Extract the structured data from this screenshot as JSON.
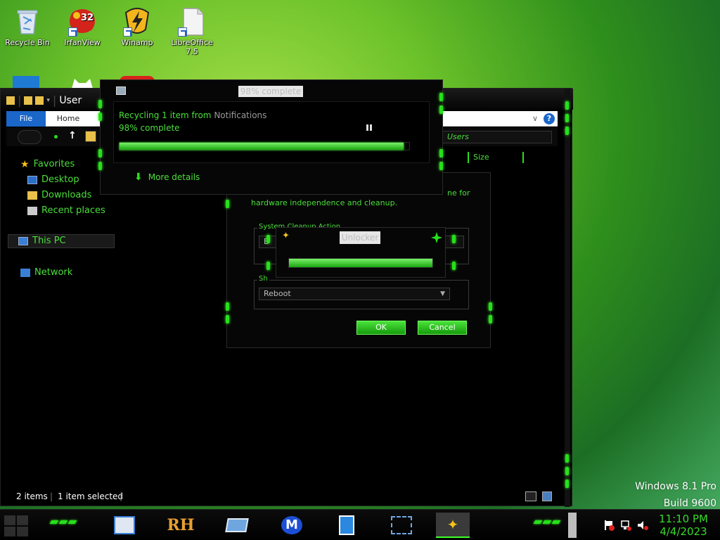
{
  "desktop": {
    "icons": [
      {
        "label": "Recycle Bin"
      },
      {
        "label": "IrfanView",
        "badge": "32"
      },
      {
        "label": "Winamp"
      },
      {
        "label": "LibreOffice 7.5"
      }
    ]
  },
  "explorer": {
    "title": "User",
    "ribbon_tabs": [
      "File",
      "Home"
    ],
    "address_text": "Users",
    "column_size": "Size",
    "nav": {
      "favorites": "Favorites",
      "desktop": "Desktop",
      "downloads": "Downloads",
      "recent": "Recent places",
      "this_pc": "This PC",
      "network": "Network"
    },
    "status": {
      "items": "2 items",
      "selected": "1 item selected"
    }
  },
  "progress_dialog": {
    "title": "98% complete",
    "line1_prefix": "Recycling 1 item from",
    "line1_source": "Notifications",
    "line2": "98% complete",
    "progress_pct": 98,
    "more_details": "More details"
  },
  "cleanup_dialog": {
    "text_tail": "ne for",
    "text": "hardware independence and cleanup.",
    "group1_legend": "System Cleanup Action",
    "group1_value": "E",
    "group2_legend": "Sh",
    "group2_value": "Reboot",
    "ok": "OK",
    "cancel": "Cancel"
  },
  "unlocker_dialog": {
    "title": "Unlocker",
    "progress_pct": 100
  },
  "watermark": {
    "line1": "Windows 8.1 Pro",
    "line2": "Build 9600"
  },
  "taskbar": {
    "apps": [
      "control-panel",
      "rh",
      "window",
      "malwarebytes",
      "document",
      "network-setup",
      "unlocker"
    ],
    "rh_label": "RH",
    "time": "11:10 PM",
    "date": "4/4/2023"
  },
  "colors": {
    "accent_green": "#4adf3a",
    "glow_green": "#26e01a",
    "file_tab_blue": "#1b66c9"
  }
}
